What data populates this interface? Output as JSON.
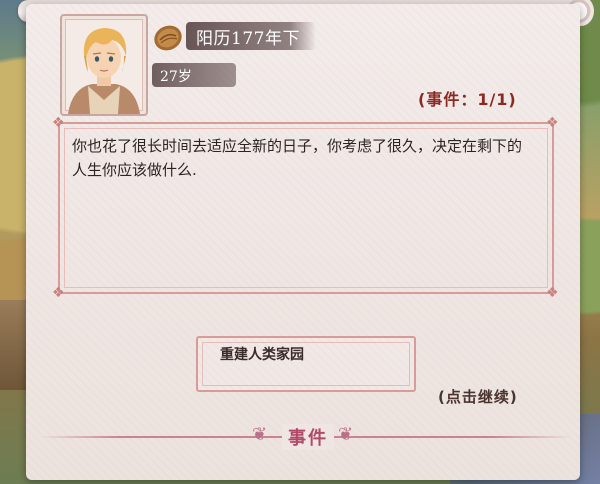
{
  "header": {
    "date": "阳历177年下",
    "age": "27岁"
  },
  "event_counter": "(事件：1/1)",
  "event_text": "你也花了很长时间去适应全新的日子，你考虑了很久，决定在剩下的人生你应该做什么.",
  "choices": [
    {
      "label": "重建人类家园"
    }
  ],
  "continue_hint": "(点击继续)",
  "footer": {
    "title": "事件"
  },
  "colors": {
    "accent": "#8a2a22",
    "frame": "#d99a9a",
    "footer_accent": "#b14a6a",
    "parchment": "#efe6e3"
  },
  "icons": [
    "coin-icon",
    "portrait-avatar"
  ]
}
